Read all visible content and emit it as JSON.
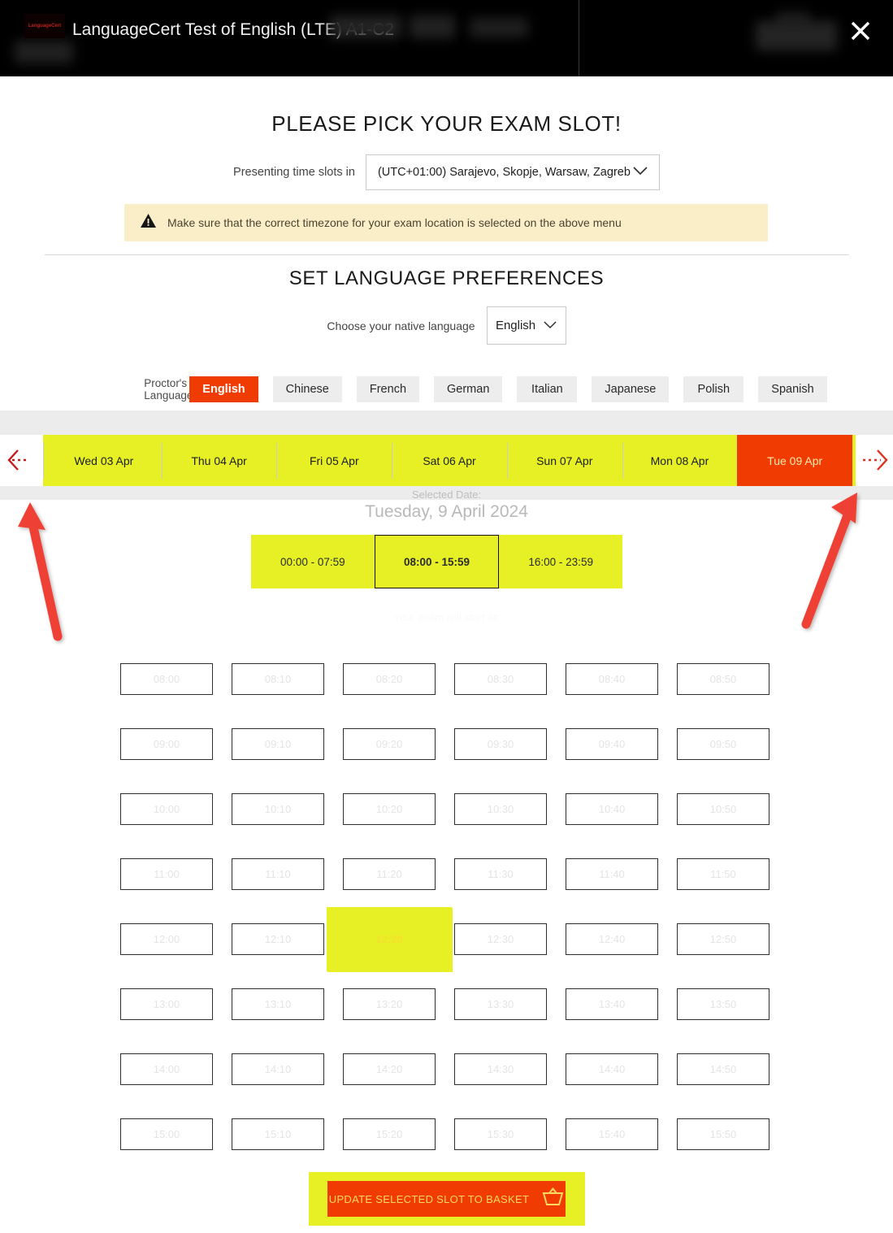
{
  "header": {
    "logo_text": "LanguageCert",
    "title": "LanguageCert Test of English (LTE) A1-C2",
    "close_label": "×"
  },
  "page": {
    "title": "PLEASE PICK YOUR EXAM SLOT!",
    "timezone_label": "Presenting time slots in",
    "timezone_value": "(UTC+01:00) Sarajevo, Skopje, Warsaw, Zagreb",
    "warning": "Make sure that the correct timezone for your exam location is selected on the above menu",
    "section_title": "SET LANGUAGE PREFERENCES"
  },
  "language": {
    "native_label": "Choose your native language",
    "native_value": "English",
    "proctor_label": "Proctor's Language",
    "proctor_options": [
      {
        "label": "English",
        "active": true
      },
      {
        "label": "Chinese",
        "active": false
      },
      {
        "label": "French",
        "active": false
      },
      {
        "label": "German",
        "active": false
      },
      {
        "label": "Italian",
        "active": false
      },
      {
        "label": "Japanese",
        "active": false
      },
      {
        "label": "Polish",
        "active": false
      },
      {
        "label": "Spanish",
        "active": false
      }
    ]
  },
  "dates": {
    "prev_label": "previous-week",
    "next_label": "next-week",
    "items": [
      {
        "label": "Wed 03 Apr",
        "selected": false
      },
      {
        "label": "Thu 04 Apr",
        "selected": false
      },
      {
        "label": "Fri 05 Apr",
        "selected": false
      },
      {
        "label": "Sat 06 Apr",
        "selected": false
      },
      {
        "label": "Sun 07 Apr",
        "selected": false
      },
      {
        "label": "Mon 08 Apr",
        "selected": false
      },
      {
        "label": "Tue 09 Apr",
        "selected": true
      }
    ]
  },
  "selected_date": {
    "caption": "Selected Date:",
    "value": "Tuesday, 9 April 2024"
  },
  "periods": [
    {
      "label": "00:00 - 07:59",
      "active": false
    },
    {
      "label": "08:00 - 15:59",
      "active": true
    },
    {
      "label": "16:00 - 23:59",
      "active": false
    }
  ],
  "start_hint": "Your exam will start at:",
  "slots": [
    {
      "label": "08:00",
      "selected": false
    },
    {
      "label": "08:10",
      "selected": false
    },
    {
      "label": "08:20",
      "selected": false
    },
    {
      "label": "08:30",
      "selected": false
    },
    {
      "label": "08:40",
      "selected": false
    },
    {
      "label": "08:50",
      "selected": false
    },
    {
      "label": "09:00",
      "selected": false
    },
    {
      "label": "09:10",
      "selected": false
    },
    {
      "label": "09:20",
      "selected": false
    },
    {
      "label": "09:30",
      "selected": false
    },
    {
      "label": "09:40",
      "selected": false
    },
    {
      "label": "09:50",
      "selected": false
    },
    {
      "label": "10:00",
      "selected": false
    },
    {
      "label": "10:10",
      "selected": false
    },
    {
      "label": "10:20",
      "selected": false
    },
    {
      "label": "10:30",
      "selected": false
    },
    {
      "label": "10:40",
      "selected": false
    },
    {
      "label": "10:50",
      "selected": false
    },
    {
      "label": "11:00",
      "selected": false
    },
    {
      "label": "11:10",
      "selected": false
    },
    {
      "label": "11:20",
      "selected": false
    },
    {
      "label": "11:30",
      "selected": false
    },
    {
      "label": "11:40",
      "selected": false
    },
    {
      "label": "11:50",
      "selected": false
    },
    {
      "label": "12:00",
      "selected": false
    },
    {
      "label": "12:10",
      "selected": false
    },
    {
      "label": "12:20",
      "selected": true
    },
    {
      "label": "12:30",
      "selected": false
    },
    {
      "label": "12:40",
      "selected": false
    },
    {
      "label": "12:50",
      "selected": false
    },
    {
      "label": "13:00",
      "selected": false
    },
    {
      "label": "13:10",
      "selected": false
    },
    {
      "label": "13:20",
      "selected": false
    },
    {
      "label": "13:30",
      "selected": false
    },
    {
      "label": "13:40",
      "selected": false
    },
    {
      "label": "13:50",
      "selected": false
    },
    {
      "label": "14:00",
      "selected": false
    },
    {
      "label": "14:10",
      "selected": false
    },
    {
      "label": "14:20",
      "selected": false
    },
    {
      "label": "14:30",
      "selected": false
    },
    {
      "label": "14:40",
      "selected": false
    },
    {
      "label": "14:50",
      "selected": false
    },
    {
      "label": "15:00",
      "selected": false
    },
    {
      "label": "15:10",
      "selected": false
    },
    {
      "label": "15:20",
      "selected": false
    },
    {
      "label": "15:30",
      "selected": false
    },
    {
      "label": "15:40",
      "selected": false
    },
    {
      "label": "15:50",
      "selected": false
    }
  ],
  "cta": {
    "label": "UPDATE SELECTED SLOT TO BASKET",
    "icon": "basket-icon"
  },
  "colors": {
    "brand_red": "#f03c02",
    "highlight_yellow": "#e6f024",
    "warning_bg": "#faeec8",
    "annotation_red": "#ef4136",
    "header_bg": "#000000"
  }
}
